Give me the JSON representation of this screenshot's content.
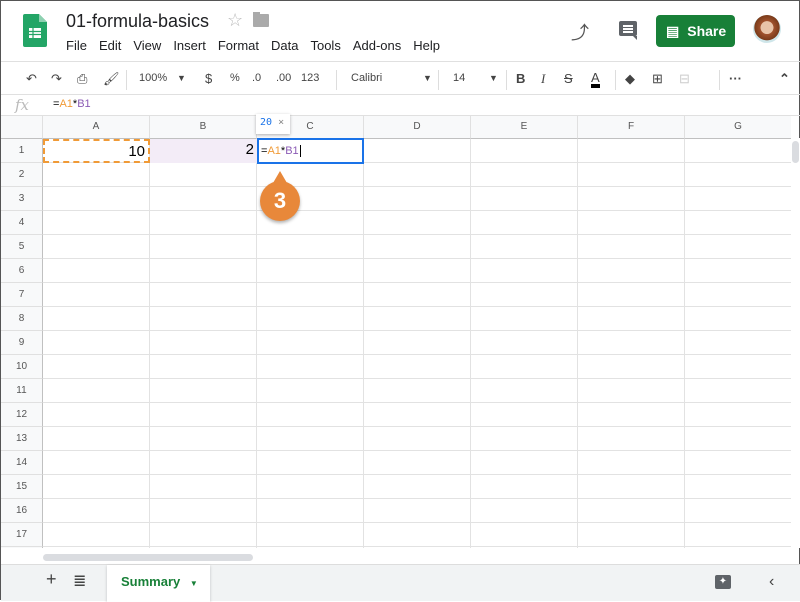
{
  "title": "01-formula-basics",
  "menu": [
    "File",
    "Edit",
    "View",
    "Insert",
    "Format",
    "Data",
    "Tools",
    "Add-ons",
    "Help"
  ],
  "share_label": "Share",
  "toolbar": {
    "zoom": "100%",
    "currency": "$",
    "percent": "%",
    "dec_less": ".0",
    "dec_more": ".00",
    "format": "123",
    "font": "Calibri",
    "size": "14"
  },
  "formula_bar": {
    "prefix": "=",
    "ref_a": "A1",
    "op": "*",
    "ref_b": "B1"
  },
  "columns": [
    "A",
    "B",
    "C",
    "D",
    "E",
    "F",
    "G"
  ],
  "rows": [
    "1",
    "2",
    "3",
    "4",
    "5",
    "6",
    "7",
    "8",
    "9",
    "10",
    "11",
    "12",
    "13",
    "14",
    "15",
    "16",
    "17"
  ],
  "cells": {
    "A1": "10",
    "B1": "2"
  },
  "tooltip": {
    "value": "20",
    "close": "×"
  },
  "callout": "3",
  "sheet": {
    "tab": "Summary"
  }
}
